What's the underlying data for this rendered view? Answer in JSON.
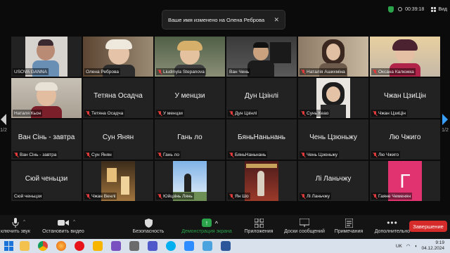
{
  "topbar": {
    "timer": "00:39:18",
    "view_label": "Вид"
  },
  "toast": {
    "message": "Ваше имя изменено на Олена Реброва",
    "close": "✕"
  },
  "pager": {
    "left": "1/2",
    "right": "1/2"
  },
  "tiles": [
    {
      "label": "USOVA GANNA",
      "mic_off": false,
      "big": "",
      "video": true
    },
    {
      "label": "Олена Реброва",
      "mic_off": false,
      "big": "",
      "video": true
    },
    {
      "label": "Liudmyla Stepanova",
      "mic_off": true,
      "big": "",
      "video": true
    },
    {
      "label": "Ван Чень",
      "mic_off": false,
      "big": "",
      "video": true,
      "active": true
    },
    {
      "label": "Наталія Ашихміна",
      "mic_off": true,
      "big": "",
      "video": true
    },
    {
      "label": "Оксана Калюжка",
      "mic_off": true,
      "big": "",
      "video": true
    },
    {
      "label": "Наталя Кьон",
      "mic_off": false,
      "big": "",
      "video": true
    },
    {
      "label": "Тетяна Осадча",
      "mic_off": true,
      "big": "Тетяна Осадча",
      "video": false
    },
    {
      "label": "У менцзи",
      "mic_off": true,
      "big": "У менцзи",
      "video": false
    },
    {
      "label": "Дун Цзінлі",
      "mic_off": true,
      "big": "Дун Цзінлі",
      "video": false
    },
    {
      "label": "Сунь Кеао",
      "mic_off": true,
      "big": "",
      "video": true
    },
    {
      "label": "Чжан ЦзиЦін",
      "mic_off": true,
      "big": "Чжан ЦзиЦін",
      "video": false
    },
    {
      "label": "Ван Сінь - завтра",
      "mic_off": true,
      "big": "Ван Сінь - завтра",
      "video": false
    },
    {
      "label": "Сун Янян",
      "mic_off": true,
      "big": "Сун Янян",
      "video": false
    },
    {
      "label": "Гань ло",
      "mic_off": true,
      "big": "Гань ло",
      "video": false
    },
    {
      "label": "БяньНаньнань",
      "mic_off": true,
      "big": "БяньНаньнань",
      "video": false
    },
    {
      "label": "Чень Цзюньжу",
      "mic_off": true,
      "big": "Чень Цзюньжу",
      "video": false
    },
    {
      "label": "Лю Чжиго",
      "mic_off": true,
      "big": "Лю Чжиго",
      "video": false
    },
    {
      "label": "Сюй ченьцзи",
      "mic_off": false,
      "big": "Сюй ченьцзи",
      "video": false
    },
    {
      "label": "Чжан Венлі",
      "mic_off": true,
      "big": "",
      "video": true
    },
    {
      "label": "Юйцзінь Лянь",
      "mic_off": true,
      "big": "",
      "video": true
    },
    {
      "label": "Ян Шо",
      "mic_off": true,
      "big": "",
      "video": true
    },
    {
      "label": "Лі Ланьчжу",
      "mic_off": true,
      "big": "Лі Ланьчжу",
      "video": false
    },
    {
      "label": "Гаяне Чеменян",
      "mic_off": true,
      "big": "",
      "video": false,
      "letter": "Г"
    }
  ],
  "toolbar": {
    "items": [
      {
        "label": "ключить звук",
        "icon": "microphone-icon"
      },
      {
        "label": "Остановить видео",
        "icon": "camera-icon"
      },
      {
        "label": "Безопасность",
        "icon": "shield-icon"
      },
      {
        "label": "Демонстрация экрана",
        "icon": "share-screen-icon"
      },
      {
        "label": "Приложения",
        "icon": "apps-icon"
      },
      {
        "label": "Доски сообщений",
        "icon": "whiteboard-icon"
      },
      {
        "label": "Примечания",
        "icon": "notes-icon"
      },
      {
        "label": "Дополнительно",
        "icon": "more-icon"
      }
    ],
    "end_label": "Завершение"
  },
  "taskbar": {
    "lang": "UK",
    "time": "9:19",
    "date": "04.12.2024"
  },
  "colors": {
    "active_speaker": "#b9e64a",
    "end_button": "#d52b2b",
    "share_green": "#2aa34a"
  }
}
